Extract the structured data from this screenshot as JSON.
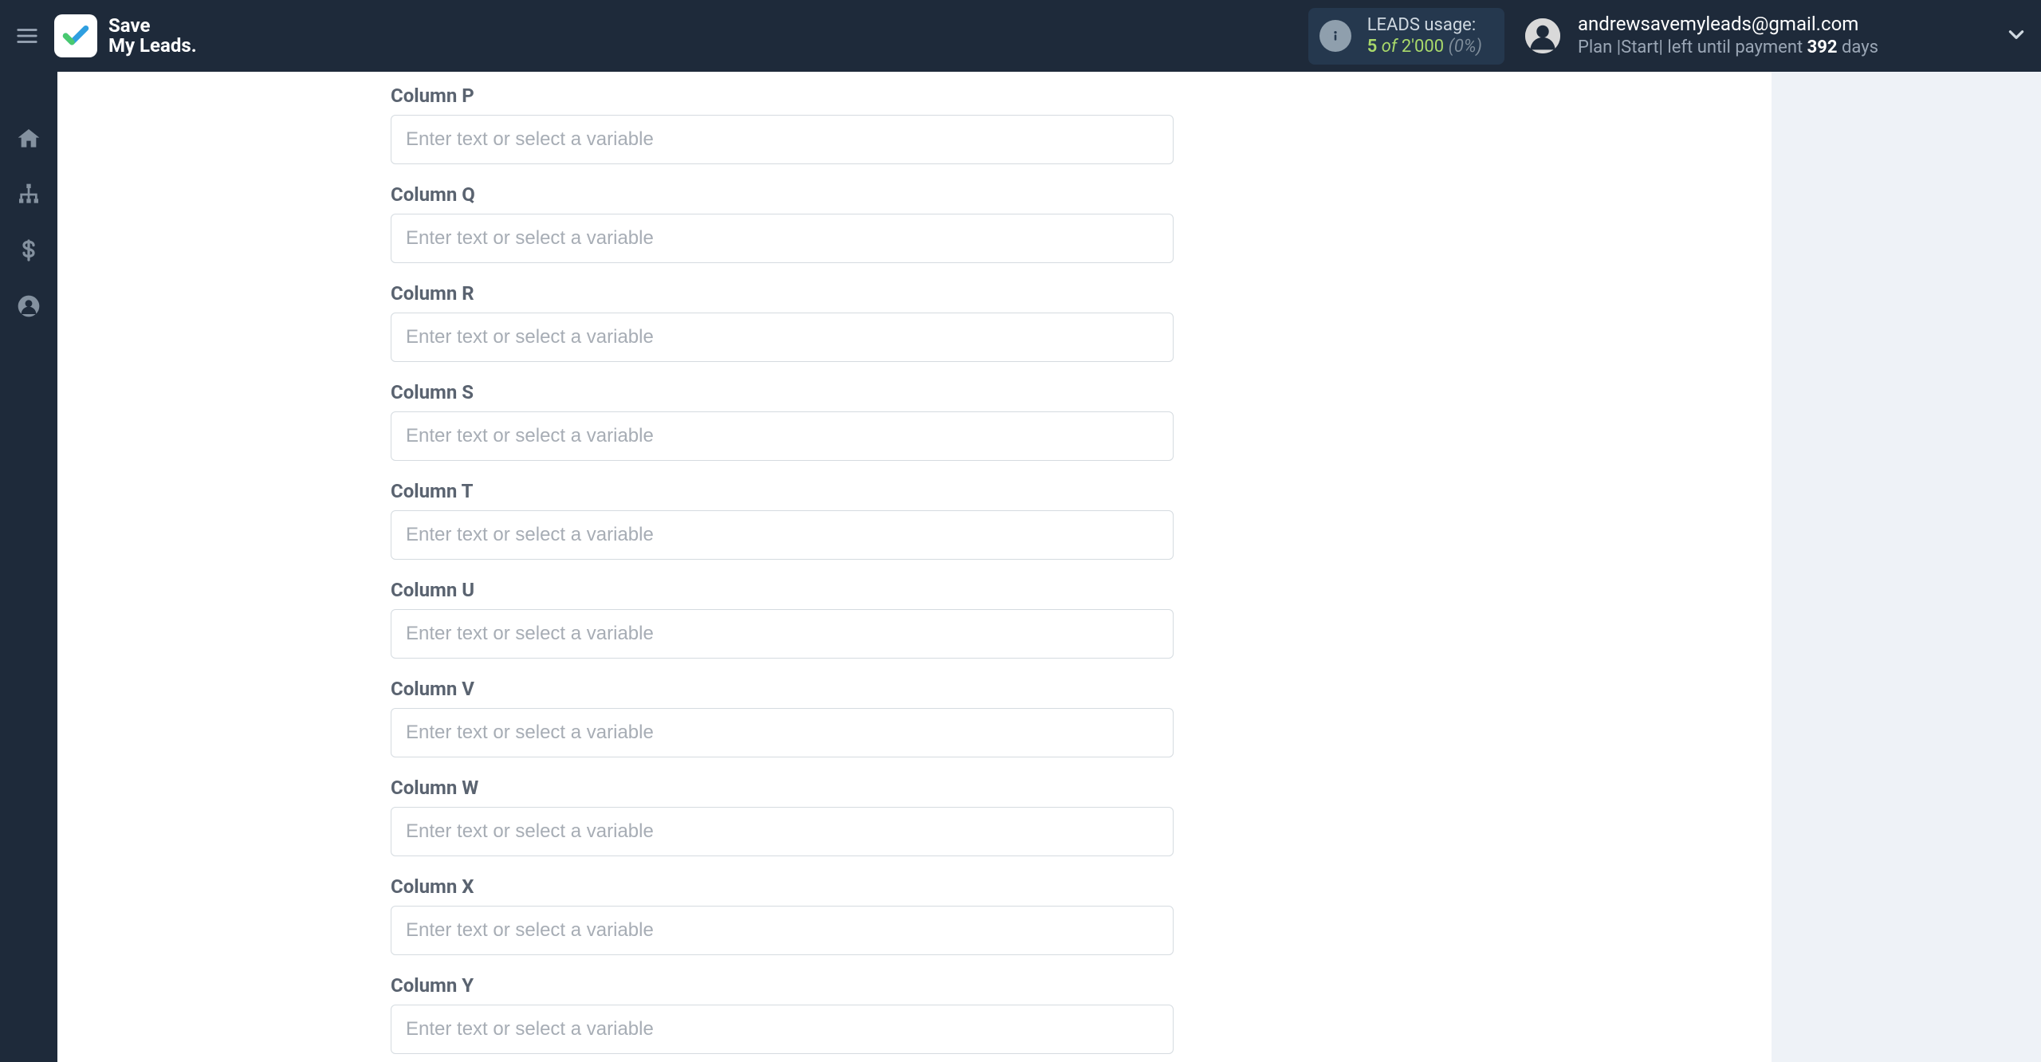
{
  "brand": {
    "line1": "Save",
    "line2": "My Leads."
  },
  "header": {
    "usage": {
      "label": "LEADS usage:",
      "used": "5",
      "of_word": "of",
      "total": "2'000",
      "pct": "(0%)"
    },
    "account": {
      "email": "andrewsavemyleads@gmail.com",
      "plan_prefix": "Plan |Start| left until payment",
      "days_value": "392",
      "days_suffix": "days"
    }
  },
  "form": {
    "placeholder": "Enter text or select a variable",
    "fields": [
      {
        "label": "Column P"
      },
      {
        "label": "Column Q"
      },
      {
        "label": "Column R"
      },
      {
        "label": "Column S"
      },
      {
        "label": "Column T"
      },
      {
        "label": "Column U"
      },
      {
        "label": "Column V"
      },
      {
        "label": "Column W"
      },
      {
        "label": "Column X"
      },
      {
        "label": "Column Y"
      }
    ]
  }
}
